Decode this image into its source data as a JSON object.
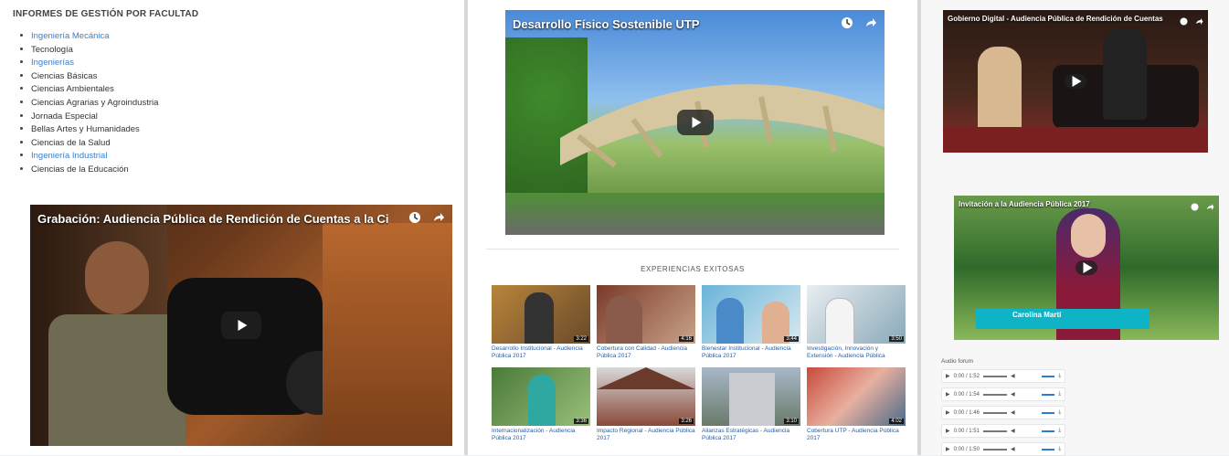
{
  "left": {
    "title": "INFORMES DE GESTIÓN POR FACULTAD",
    "faculties": [
      {
        "label": "Ingeniería Mecánica",
        "link": true
      },
      {
        "label": "Tecnología",
        "link": false
      },
      {
        "label": "Ingenierías",
        "link": true
      },
      {
        "label": "Ciencias Básicas",
        "link": false
      },
      {
        "label": "Ciencias Ambientales",
        "link": false
      },
      {
        "label": "Ciencias Agrarias y Agroindustria",
        "link": false
      },
      {
        "label": "Jornada Especial",
        "link": false
      },
      {
        "label": "Bellas Artes y Humanidades",
        "link": false
      },
      {
        "label": "Ciencias de la Salud",
        "link": false
      },
      {
        "label": "Ingeniería Industrial",
        "link": true
      },
      {
        "label": "Ciencias de la Educación",
        "link": false
      }
    ],
    "video_title": "Grabación: Audiencia Pública de Rendición de Cuentas a la Ciudad..."
  },
  "middle": {
    "video_title": "Desarrollo Físico Sostenible UTP",
    "section_title": "EXPERIENCIAS EXITOSAS",
    "thumbs": [
      {
        "caption": "Desarrollo Institucional - Audiencia Pública 2017",
        "duration": "3:22"
      },
      {
        "caption": "Cobertura con Calidad - Audiencia Pública 2017",
        "duration": "4:16"
      },
      {
        "caption": "Bienestar Institucional - Audiencia Pública 2017",
        "duration": "3:44"
      },
      {
        "caption": "Investigación, Innovación y Extensión - Audiencia Pública",
        "duration": "3:50"
      },
      {
        "caption": "Internacionalización - Audiencia Pública 2017",
        "duration": "3:36"
      },
      {
        "caption": "Impacto Regional - Audiencia Pública 2017",
        "duration": "3:26"
      },
      {
        "caption": "Alianzas Estratégicas - Audiencia Pública 2017",
        "duration": "3:10"
      },
      {
        "caption": "Cobertura UTP - Audiencia Pública 2017",
        "duration": "4:02"
      }
    ]
  },
  "right": {
    "video1_title": "Gobierno Digital - Audiencia Pública de Rendición de Cuentas",
    "video2_title": "Invitación a la Audiencia Pública 2017",
    "name_caption": "Carolina Martí",
    "audio_title": "Audio forum",
    "audio": [
      {
        "time": "0:00 / 1:52"
      },
      {
        "time": "0:00 / 1:54"
      },
      {
        "time": "0:00 / 1:46"
      },
      {
        "time": "0:00 / 1:51"
      },
      {
        "time": "0:00 / 1:50"
      }
    ]
  },
  "colors": {
    "link": "#3b7ec9",
    "caption": "#2a5d9f",
    "banner": "#0fb3c6"
  }
}
